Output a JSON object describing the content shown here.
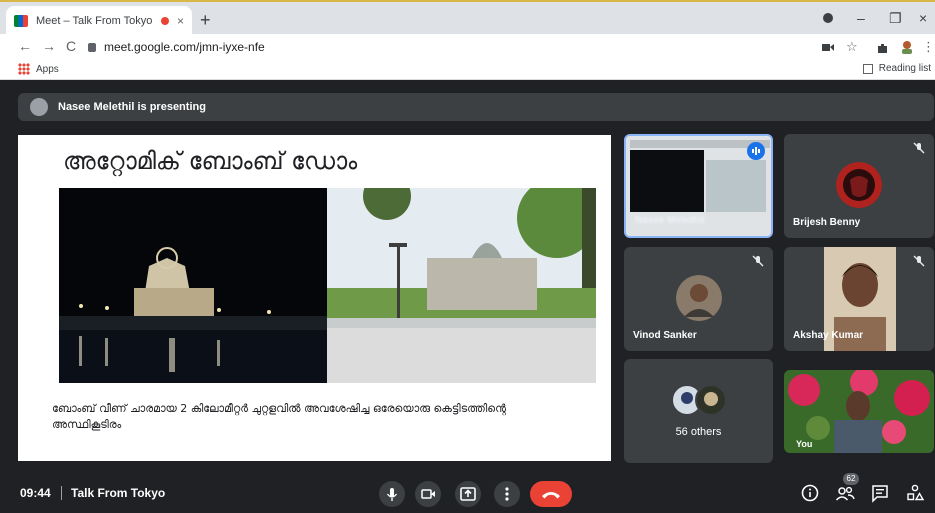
{
  "browser": {
    "tab_title": "Meet – Talk From Tokyo",
    "tab_close": "×",
    "new_tab": "+",
    "url": "meet.google.com/jmn-iyxe-nfe",
    "apps_label": "Apps",
    "reading_list_label": "Reading list",
    "nav_back": "←",
    "nav_forward": "→",
    "nav_reload": "C",
    "win_min": "–",
    "win_max": "❐",
    "win_close": "×"
  },
  "presenting_banner": "Nasee Melethil is presenting",
  "slide": {
    "title": "അറ്റോമിക് ബോംബ് ഡോം",
    "caption": "ബോംബ് വീണ് ചാരമായ 2 കിലോമീറ്റർ ചുറ്റളവിൽ അവശേഷിച്ച ഒരേയൊരു കെട്ടിടത്തിന്റെ അസ്ഥികൂടിരം"
  },
  "participants": [
    {
      "name": "Nasee Melethil",
      "muted": false,
      "speaking": true
    },
    {
      "name": "Brijesh Benny",
      "muted": true
    },
    {
      "name": "Vinod Sanker",
      "muted": true
    },
    {
      "name": "Akshay Kumar",
      "muted": true
    },
    {
      "name": "56 others"
    },
    {
      "name": "You"
    }
  ],
  "bottom_bar": {
    "time": "09:44",
    "meeting_name": "Talk From Tokyo",
    "participant_count": "62"
  },
  "colors": {
    "meet_bg": "#202124",
    "tile_bg": "#3c4043",
    "end_call": "#ea4335",
    "speaking_blue": "#8ab4f8",
    "speaking_badge": "#1a73e8"
  },
  "icons": {
    "mic": "microphone-icon",
    "camera": "camera-icon",
    "present": "present-screen-icon",
    "more": "more-options-icon",
    "end": "end-call-icon",
    "info": "info-icon",
    "people": "people-icon",
    "chat": "chat-icon",
    "activities": "activities-icon",
    "mute": "mic-off-icon"
  }
}
